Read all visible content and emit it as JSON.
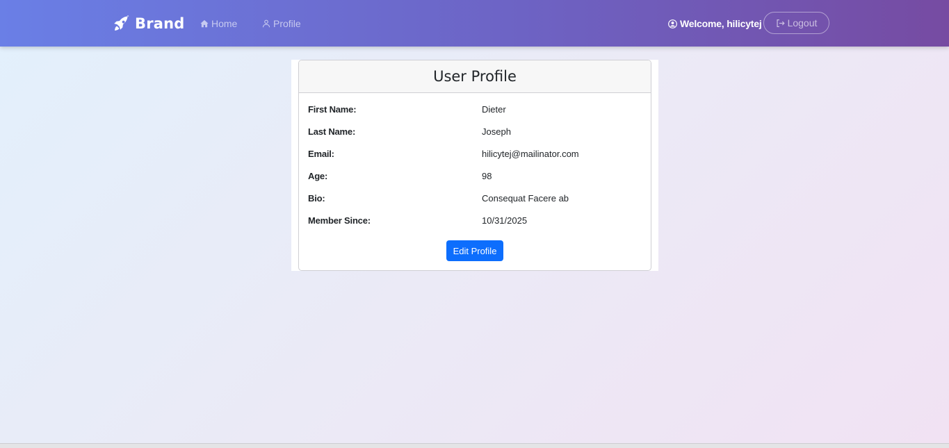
{
  "navbar": {
    "brand": "Brand",
    "brand_icon": "rocket-icon",
    "links": [
      {
        "label": "Home",
        "icon": "house-icon"
      },
      {
        "label": "Profile",
        "icon": "person-icon"
      }
    ],
    "welcome": "Welcome, hilicytej",
    "welcome_icon": "user-circle-icon",
    "logout_label": "Logout",
    "logout_icon": "logout-icon"
  },
  "profile": {
    "title": "User Profile",
    "fields": [
      {
        "label": "First Name:",
        "value": "Dieter"
      },
      {
        "label": "Last Name:",
        "value": "Joseph"
      },
      {
        "label": "Email:",
        "value": "hilicytej@mailinator.com"
      },
      {
        "label": "Age:",
        "value": "98"
      },
      {
        "label": "Bio:",
        "value": "Consequat Facere ab"
      },
      {
        "label": "Member Since:",
        "value": "10/31/2025"
      }
    ],
    "edit_label": "Edit Profile"
  },
  "colors": {
    "nav_gradient_start": "#6a7fe6",
    "nav_gradient_end": "#764ba2",
    "primary_button": "#0d6efd"
  }
}
